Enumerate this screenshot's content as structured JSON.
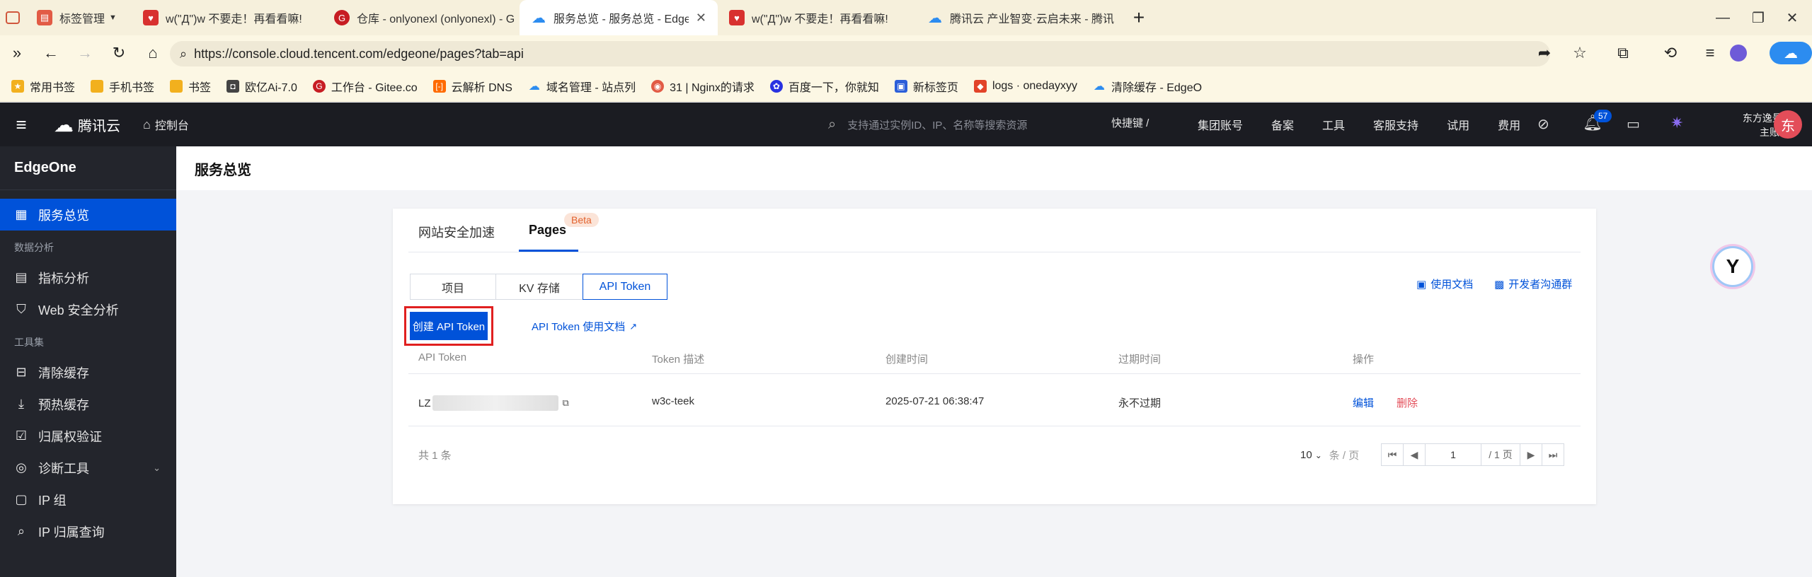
{
  "browser": {
    "tabs": [
      {
        "label": "标签管理",
        "icon": "tab-manager-icon",
        "color": "#e25b45"
      },
      {
        "label": "w(\"Д\")w 不要走！再看看嘛!",
        "icon": "bookmark-heart-icon",
        "color": "#d8312f"
      },
      {
        "label": "仓库 - onlyonexl (onlyonexl) - G",
        "icon": "gitee-icon",
        "color": "#c71d23"
      },
      {
        "label": "服务总览 - 服务总览 - EdgeO",
        "icon": "tencent-cloud-icon",
        "color": "#2c8cf0",
        "active": true
      },
      {
        "label": "w(\"Д\")w 不要走！再看看嘛!",
        "icon": "bookmark-heart-icon",
        "color": "#d8312f"
      },
      {
        "label": "腾讯云 产业智变·云启未来 - 腾讯",
        "icon": "tencent-cloud-icon",
        "color": "#2c8cf0"
      }
    ],
    "new_tab": "+",
    "url": "https://console.cloud.tencent.com/edgeone/pages?tab=api",
    "bookmarks": [
      {
        "label": "常用书签",
        "color": "#f2b01e"
      },
      {
        "label": "手机书签",
        "color": "#f2b01e"
      },
      {
        "label": "书签",
        "color": "#f2b01e"
      },
      {
        "label": "欧亿Ai-7.0",
        "color": "#444444"
      },
      {
        "label": "工作台 - Gitee.co",
        "color": "#c71d23"
      },
      {
        "label": "云解析 DNS",
        "color": "#ff6a00"
      },
      {
        "label": "域名管理 - 站点列",
        "color": "#2c8cf0"
      },
      {
        "label": "31 | Nginx的请求",
        "color": "#e25b45"
      },
      {
        "label": "百度一下，你就知",
        "color": "#2932e1"
      },
      {
        "label": "新标签页",
        "color": "#2c5fd9"
      },
      {
        "label": "logs · onedayxyy",
        "color": "#e24329"
      },
      {
        "label": "清除缓存 - EdgeO",
        "color": "#2c8cf0"
      }
    ]
  },
  "topbar": {
    "brand": "腾讯云",
    "console": "控制台",
    "search_placeholder": "支持通过实例ID、IP、名称等搜索资源",
    "shortcut": "快捷键 /",
    "links": [
      "集团账号",
      "备案",
      "工具",
      "客服支持",
      "试用",
      "费用"
    ],
    "notify_count": "57",
    "user_name": "东方逸景xl",
    "user_role": "主账号",
    "avatar_text": "东"
  },
  "sidebar": {
    "title": "EdgeOne",
    "sections": [
      {
        "items": [
          {
            "label": "服务总览",
            "icon": "grid-icon",
            "active": true
          }
        ]
      },
      {
        "group": "数据分析",
        "items": [
          {
            "label": "指标分析",
            "icon": "chart-icon"
          },
          {
            "label": "Web 安全分析",
            "icon": "shield-icon"
          }
        ]
      },
      {
        "group": "工具集",
        "items": [
          {
            "label": "清除缓存",
            "icon": "broom-icon"
          },
          {
            "label": "预热缓存",
            "icon": "download-icon"
          },
          {
            "label": "归属权验证",
            "icon": "verify-icon"
          },
          {
            "label": "诊断工具",
            "icon": "pulse-icon",
            "expandable": true
          },
          {
            "label": "IP 组",
            "icon": "ip-icon"
          },
          {
            "label": "IP 归属查询",
            "icon": "search-icon"
          }
        ]
      }
    ]
  },
  "main": {
    "page_title": "服务总览",
    "tabs": [
      {
        "label": "网站安全加速"
      },
      {
        "label": "Pages",
        "badge": "Beta",
        "active": true
      }
    ],
    "subtabs": [
      "项目",
      "KV 存储",
      "API Token"
    ],
    "active_subtab": "API Token",
    "doc_link": "使用文档",
    "dev_link": "开发者沟通群",
    "create_button": "创建 API Token",
    "api_doc_link": "API Token 使用文档",
    "table": {
      "headers": [
        "API Token",
        "Token 描述",
        "创建时间",
        "过期时间",
        "操作"
      ],
      "rows": [
        {
          "token": "LZ",
          "desc": "w3c-teek",
          "created": "2025-07-21 06:38:47",
          "expires": "永不过期",
          "edit": "编辑",
          "delete": "删除"
        }
      ]
    },
    "total": "共 1 条",
    "page_size": "10",
    "page_size_unit": "条 / 页",
    "current_page": "1",
    "total_pages": "/ 1 页"
  },
  "colors": {
    "primary": "#0052d9",
    "danger": "#e34d59",
    "sidebar_bg": "#23252c",
    "topbar_bg": "#1b1c22",
    "highlight_box": "#e02020"
  }
}
